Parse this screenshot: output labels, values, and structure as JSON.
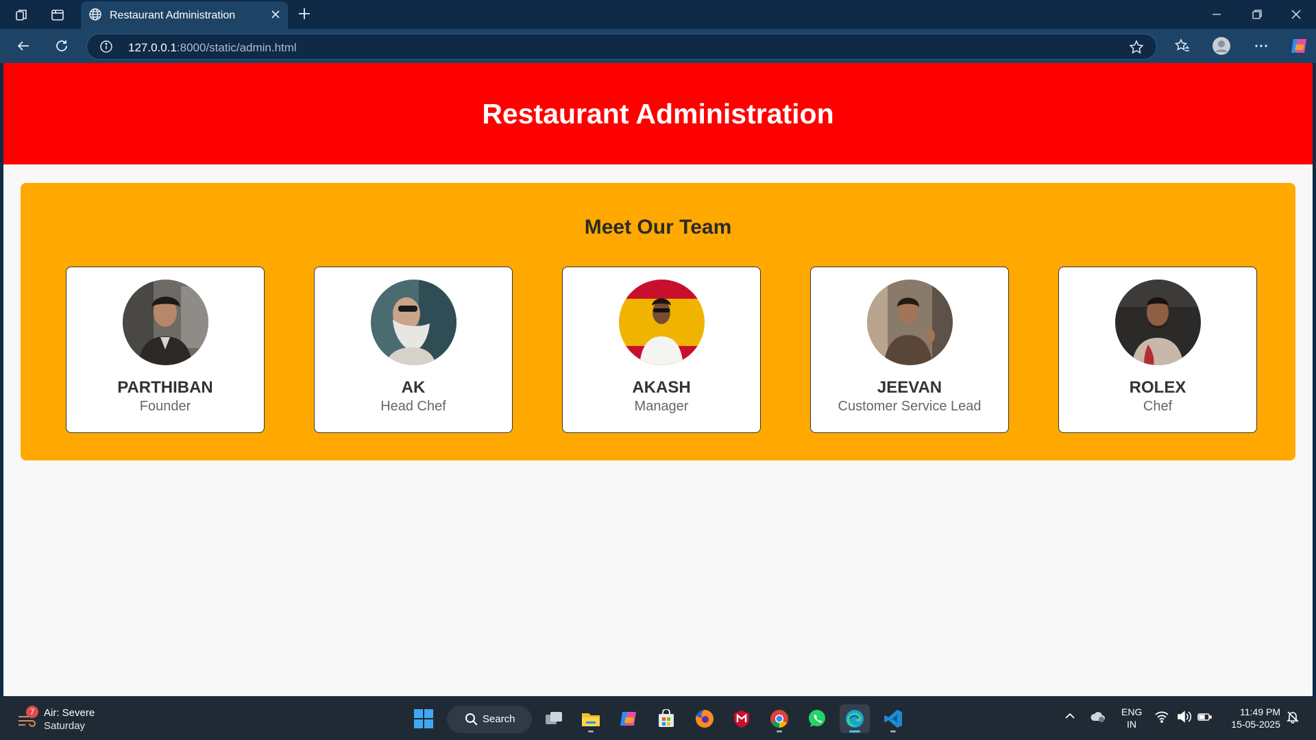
{
  "browser": {
    "tab_title": "Restaurant Administration",
    "url_host": "127.0.0.1",
    "url_rest": ":8000/static/admin.html"
  },
  "page": {
    "header_title": "Restaurant Administration",
    "section_title": "Meet Our Team",
    "team": [
      {
        "name": "PARTHIBAN",
        "role": "Founder"
      },
      {
        "name": "AK",
        "role": "Head Chef"
      },
      {
        "name": "AKASH",
        "role": "Manager"
      },
      {
        "name": "JEEVAN",
        "role": "Customer Service Lead"
      },
      {
        "name": "ROLEX",
        "role": "Chef"
      }
    ]
  },
  "taskbar": {
    "weather_badge": "7",
    "weather_label": "Air: Severe",
    "weather_day": "Saturday",
    "search_label": "Search",
    "lang_1": "ENG",
    "lang_2": "IN",
    "time": "11:49 PM",
    "date": "15-05-2025"
  },
  "colors": {
    "header": "#ff0000",
    "team_section": "#ffa900",
    "chrome": "#0e2a47"
  }
}
